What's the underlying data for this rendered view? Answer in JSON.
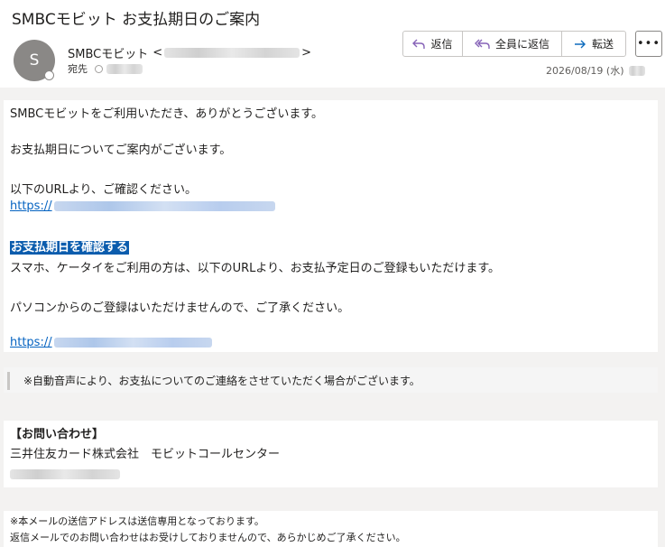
{
  "message": {
    "subject": "SMBCモビット お支払期日のご案内",
    "avatar_initial": "S",
    "sender_name": "SMBCモビット",
    "sender_open": "<",
    "sender_close": ">",
    "to_label": "宛先",
    "date": "2026/08/19 (水)"
  },
  "actions": {
    "reply": "返信",
    "reply_all": "全員に返信",
    "forward": "転送",
    "more": "•••"
  },
  "body": {
    "greeting": "SMBCモビットをご利用いただき、ありがとうございます。",
    "info": "お支払期日についてご案内がございます。",
    "instruction": "以下のURLより、ご確認ください。",
    "url1_prefix": "https://",
    "highlight_link": "お支払期日を確認する",
    "mobile_note": "スマホ、ケータイをご利用の方は、以下のURLより、お支払予定日のご登録もいただけます。",
    "pc_note": "パソコンからのご登録はいただけませんので、ご了承ください。",
    "url2_prefix": "https://"
  },
  "notice": "※自動音声により、お支払についてのご連絡をさせていただく場合がございます。",
  "contact": {
    "heading": "【お問い合わせ】",
    "company": "三井住友カード株式会社　モビットコールセンター"
  },
  "footer": {
    "line1": "※本メールの送信アドレスは送信専用となっております。",
    "line2": "返信メールでのお問い合わせはお受けしておりませんので、あらかじめご了承ください。"
  },
  "colors": {
    "link": "#0563c1",
    "highlight_bg": "#0b5cad",
    "reply_icon": "#8764b8",
    "forward_icon": "#0f6cbd"
  }
}
